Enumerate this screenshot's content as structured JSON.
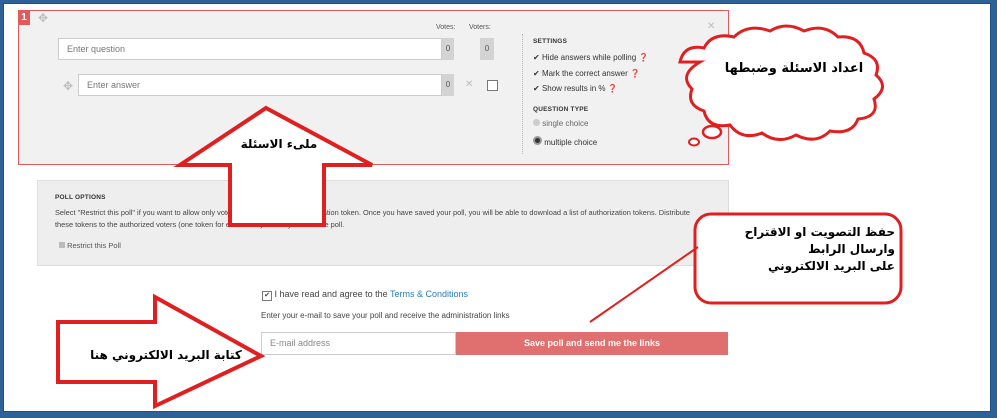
{
  "question": {
    "number": "1",
    "placeholder": "Enter question",
    "answer_placeholder": "Enter answer",
    "votes_label": "Votes:",
    "voters_label": "Voters:",
    "votes_count": "0",
    "voters_count": "0",
    "answer_votes": "0"
  },
  "settings": {
    "title": "SETTINGS",
    "items": [
      "Hide answers while polling",
      "Mark the correct answer",
      "Show results in %"
    ],
    "type_title": "QUESTION TYPE",
    "types": [
      "single choice",
      "multiple choice"
    ],
    "selected_type": "multiple choice"
  },
  "poll_options": {
    "title": "POLL OPTIONS",
    "text": "Select \"Restrict this poll\" if you want to allow only voters who have a valid authorization token. Once you have saved your poll, you will be able to download a list of authorization tokens. Distribute these tokens to the authorized voters (one token for each voter) before you start the poll.",
    "restrict_label": "Restrict this Poll"
  },
  "form": {
    "agree_text": "I have read and agree to the ",
    "terms_link": "Terms & Conditions",
    "email_note": "Enter your e-mail to save your poll and receive the administration links",
    "email_placeholder": "E-mail address",
    "save_label": "Save poll and send me the links"
  },
  "annotations": {
    "cloud": "اعداد الاسئلة وضبطها",
    "up_arrow": "ملىء الاسئلة",
    "box_lines": [
      "حفظ التصويت او الاقتراح",
      "وارسال الرابط",
      "على البريد الالكتروني"
    ],
    "right_arrow": "كتابة البريد الالكتروني هنا"
  },
  "colors": {
    "accent": "#e05c5c",
    "annotation": "#e02020",
    "link": "#2b7bb9",
    "frame": "#2d6299"
  }
}
